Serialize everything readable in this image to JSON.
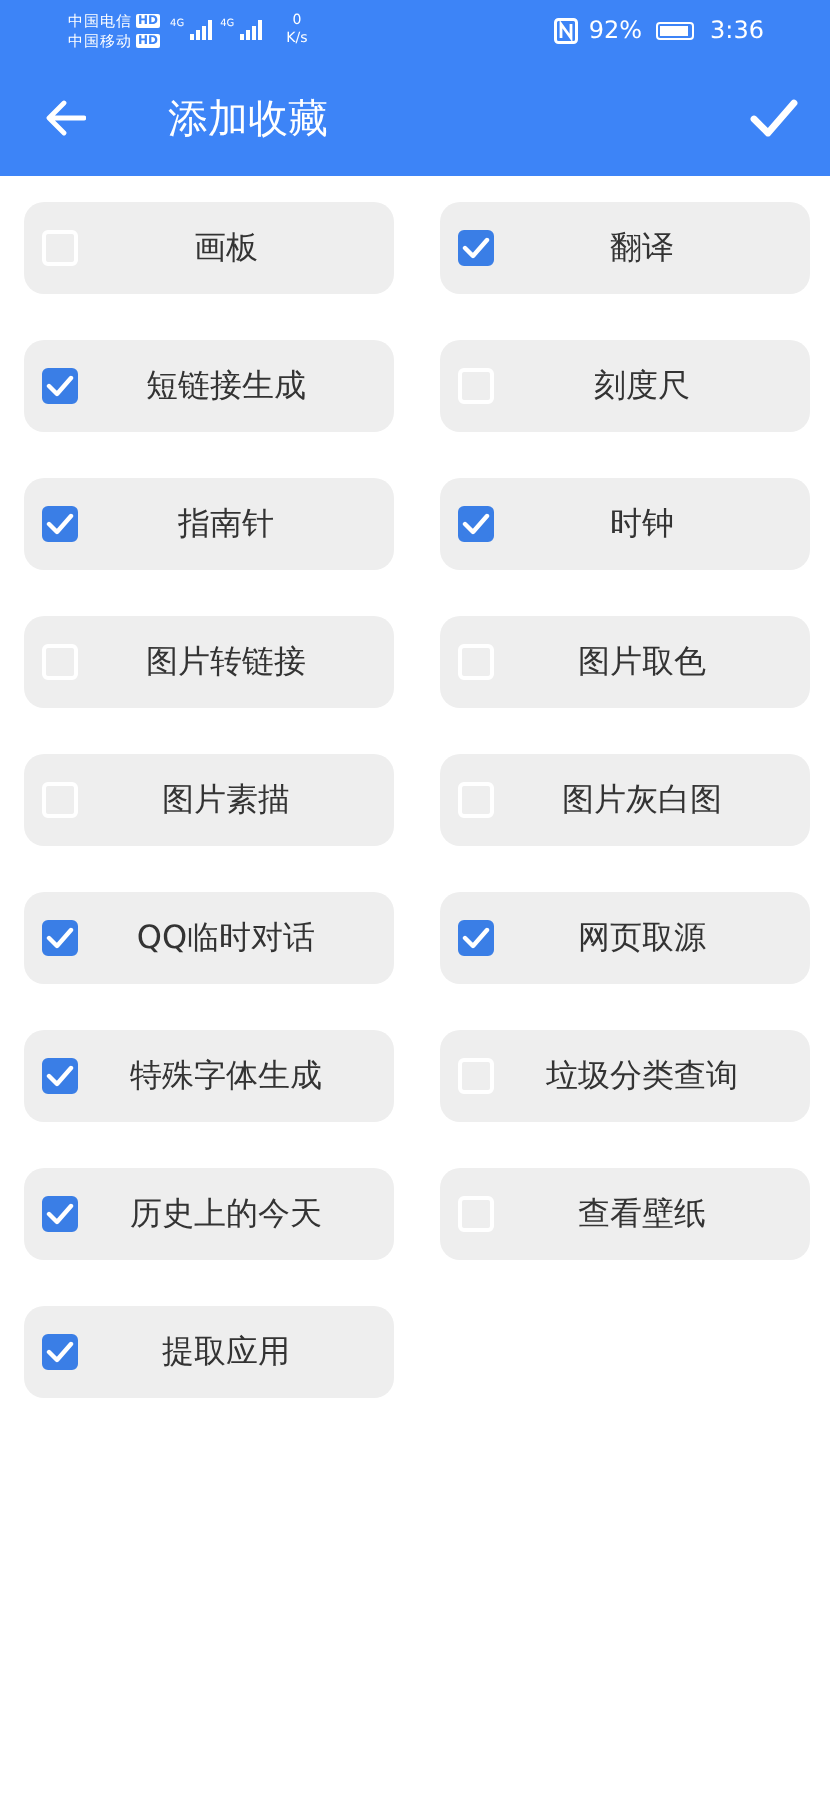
{
  "status_bar": {
    "carriers": [
      {
        "name": "中国电信",
        "badge": "HD"
      },
      {
        "name": "中国移动",
        "badge": "HD"
      }
    ],
    "networks": [
      "4G",
      "4G"
    ],
    "speed_value": "0",
    "speed_unit": "K/s",
    "battery_text": "92%",
    "time": "3:36"
  },
  "header": {
    "title": "添加收藏"
  },
  "items": [
    {
      "label": "画板",
      "checked": false
    },
    {
      "label": "翻译",
      "checked": true
    },
    {
      "label": "短链接生成",
      "checked": true
    },
    {
      "label": "刻度尺",
      "checked": false
    },
    {
      "label": "指南针",
      "checked": true
    },
    {
      "label": "时钟",
      "checked": true
    },
    {
      "label": "图片转链接",
      "checked": false
    },
    {
      "label": "图片取色",
      "checked": false
    },
    {
      "label": "图片素描",
      "checked": false
    },
    {
      "label": "图片灰白图",
      "checked": false
    },
    {
      "label": "QQ临时对话",
      "checked": true
    },
    {
      "label": "网页取源",
      "checked": true
    },
    {
      "label": "特殊字体生成",
      "checked": true
    },
    {
      "label": "垃圾分类查询",
      "checked": false
    },
    {
      "label": "历史上的今天",
      "checked": true
    },
    {
      "label": "查看壁纸",
      "checked": false
    },
    {
      "label": "提取应用",
      "checked": true
    }
  ]
}
